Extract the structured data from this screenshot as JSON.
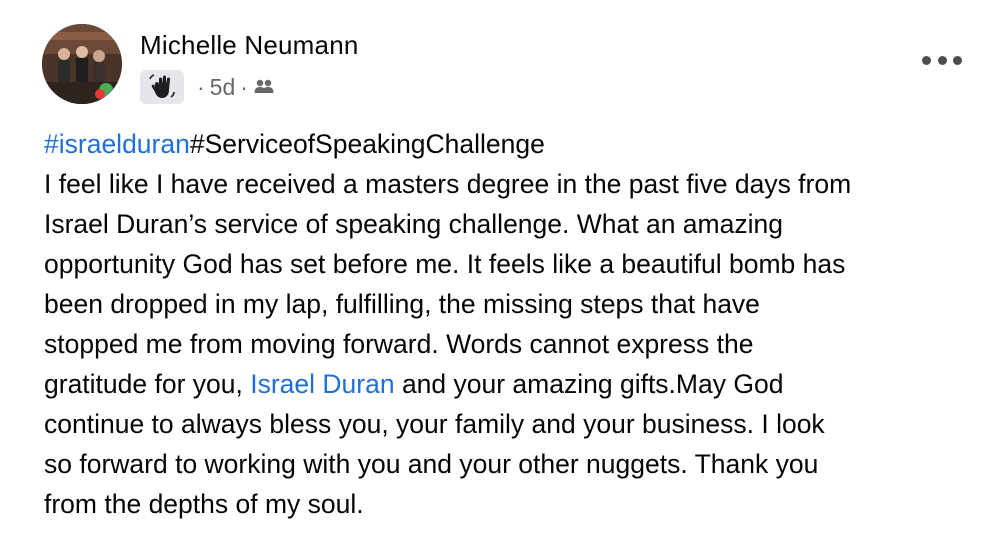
{
  "author": {
    "name": "Michelle Neumann"
  },
  "meta": {
    "time": "5d",
    "separator": "·",
    "badge_icon": "waving-hand-icon",
    "audience_icon": "friends-audience-icon"
  },
  "post": {
    "hashtag_1": "#israelduran",
    "hashtag_2": "#ServiceofSpeakingChallenge",
    "lines": [
      "I feel like I have received a masters degree in the past five days from",
      "Israel Duran’s service of speaking challenge. What an amazing",
      "opportunity God has set before me. It feels like a beautiful bomb has",
      "been dropped in my lap, fulfilling, the missing steps that have",
      "stopped me from moving forward. Words cannot express the"
    ],
    "line_tag_before": "gratitude for you, ",
    "tagged_person": "Israel Duran",
    "line_tag_after": " and your amazing gifts.May God",
    "lines_after": [
      "continue to always bless you, your family and your business. I look",
      "so forward to working with you and your other nuggets. Thank you",
      "from the depths of my soul."
    ]
  },
  "colors": {
    "link": "#216fdb",
    "text": "#050505",
    "meta": "#65676b"
  }
}
